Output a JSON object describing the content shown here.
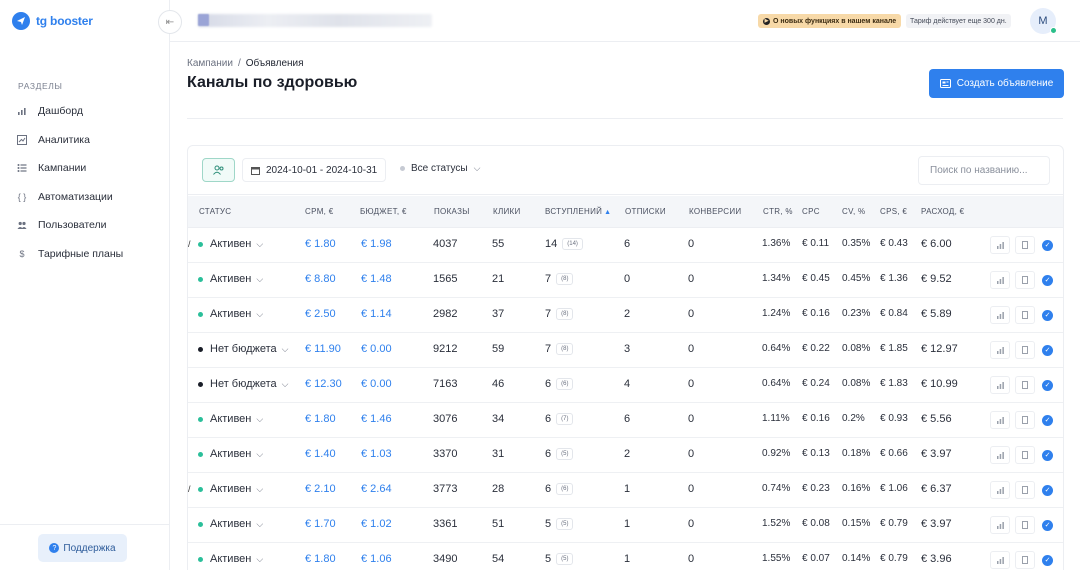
{
  "app": {
    "logo_text": "tg booster"
  },
  "sidebar": {
    "section_title": "РАЗДЕЛЫ",
    "items": [
      {
        "label": "Дашборд",
        "icon": "bar-chart-icon"
      },
      {
        "label": "Аналитика",
        "icon": "analytics-icon"
      },
      {
        "label": "Кампании",
        "icon": "list-icon"
      },
      {
        "label": "Автоматизации",
        "icon": "braces-icon"
      },
      {
        "label": "Пользователи",
        "icon": "users-icon"
      },
      {
        "label": "Тарифные планы",
        "icon": "dollar-icon"
      }
    ],
    "support_label": "Поддержка"
  },
  "topbar": {
    "news_label": "О новых функциях в нашем канале",
    "tariff_label": "Тариф действует еще 300 дн.",
    "avatar_initial": "M"
  },
  "breadcrumb": {
    "parent": "Кампании",
    "separator": "/",
    "current": "Объявления"
  },
  "page_title": "Каналы по здоровью",
  "create_button_label": "Создать объявление",
  "filters": {
    "date_range": "2024-10-01 - 2024-10-31",
    "status_select": "Все статусы",
    "search_placeholder": "Поиск по названию..."
  },
  "table": {
    "headers": {
      "status": "СТАТУС",
      "cpm": "CPM, €",
      "budget": "БЮДЖЕТ, €",
      "views": "ПОКАЗЫ",
      "clicks": "КЛИКИ",
      "joins": "ВСТУПЛЕНИЙ",
      "unsubs": "ОТПИСКИ",
      "conv": "КОНВЕРСИИ",
      "ctr": "CTR, %",
      "cpc": "CPC",
      "cv": "CV, %",
      "cps": "CPS, €",
      "spend": "РАСХОД, €"
    },
    "colors": {
      "active": "#2bbf9a",
      "no_budget": "#1a1e28",
      "link": "#2f80ed"
    },
    "rows": [
      {
        "status": "Активен",
        "active": true,
        "cpm": "€ 1.80",
        "budget": "€ 1.98",
        "views": "4037",
        "clicks": "55",
        "joins": "14",
        "joins_sub": "(14)",
        "unsubs": "6",
        "conv": "0",
        "ctr": "1.36%",
        "cpc": "€ 0.11",
        "cv": "0.35%",
        "cps": "€ 0.43",
        "spend": "€ 6.00",
        "mark": "/"
      },
      {
        "status": "Активен",
        "active": true,
        "cpm": "€ 8.80",
        "budget": "€ 1.48",
        "views": "1565",
        "clicks": "21",
        "joins": "7",
        "joins_sub": "(8)",
        "unsubs": "0",
        "conv": "0",
        "ctr": "1.34%",
        "cpc": "€ 0.45",
        "cv": "0.45%",
        "cps": "€ 1.36",
        "spend": "€ 9.52",
        "mark": ""
      },
      {
        "status": "Активен",
        "active": true,
        "cpm": "€ 2.50",
        "budget": "€ 1.14",
        "views": "2982",
        "clicks": "37",
        "joins": "7",
        "joins_sub": "(8)",
        "unsubs": "2",
        "conv": "0",
        "ctr": "1.24%",
        "cpc": "€ 0.16",
        "cv": "0.23%",
        "cps": "€ 0.84",
        "spend": "€ 5.89",
        "mark": ""
      },
      {
        "status": "Нет бюджета",
        "active": false,
        "cpm": "€ 11.90",
        "budget": "€ 0.00",
        "views": "9212",
        "clicks": "59",
        "joins": "7",
        "joins_sub": "(8)",
        "unsubs": "3",
        "conv": "0",
        "ctr": "0.64%",
        "cpc": "€ 0.22",
        "cv": "0.08%",
        "cps": "€ 1.85",
        "spend": "€ 12.97",
        "mark": ""
      },
      {
        "status": "Нет бюджета",
        "active": false,
        "cpm": "€ 12.30",
        "budget": "€ 0.00",
        "views": "7163",
        "clicks": "46",
        "joins": "6",
        "joins_sub": "(6)",
        "unsubs": "4",
        "conv": "0",
        "ctr": "0.64%",
        "cpc": "€ 0.24",
        "cv": "0.08%",
        "cps": "€ 1.83",
        "spend": "€ 10.99",
        "mark": ""
      },
      {
        "status": "Активен",
        "active": true,
        "cpm": "€ 1.80",
        "budget": "€ 1.46",
        "views": "3076",
        "clicks": "34",
        "joins": "6",
        "joins_sub": "(7)",
        "unsubs": "6",
        "conv": "0",
        "ctr": "1.11%",
        "cpc": "€ 0.16",
        "cv": "0.2%",
        "cps": "€ 0.93",
        "spend": "€ 5.56",
        "mark": ""
      },
      {
        "status": "Активен",
        "active": true,
        "cpm": "€ 1.40",
        "budget": "€ 1.03",
        "views": "3370",
        "clicks": "31",
        "joins": "6",
        "joins_sub": "(5)",
        "unsubs": "2",
        "conv": "0",
        "ctr": "0.92%",
        "cpc": "€ 0.13",
        "cv": "0.18%",
        "cps": "€ 0.66",
        "spend": "€ 3.97",
        "mark": ""
      },
      {
        "status": "Активен",
        "active": true,
        "cpm": "€ 2.10",
        "budget": "€ 2.64",
        "views": "3773",
        "clicks": "28",
        "joins": "6",
        "joins_sub": "(6)",
        "unsubs": "1",
        "conv": "0",
        "ctr": "0.74%",
        "cpc": "€ 0.23",
        "cv": "0.16%",
        "cps": "€ 1.06",
        "spend": "€ 6.37",
        "mark": "/"
      },
      {
        "status": "Активен",
        "active": true,
        "cpm": "€ 1.70",
        "budget": "€ 1.02",
        "views": "3361",
        "clicks": "51",
        "joins": "5",
        "joins_sub": "(5)",
        "unsubs": "1",
        "conv": "0",
        "ctr": "1.52%",
        "cpc": "€ 0.08",
        "cv": "0.15%",
        "cps": "€ 0.79",
        "spend": "€ 3.97",
        "mark": ""
      },
      {
        "status": "Активен",
        "active": true,
        "cpm": "€ 1.80",
        "budget": "€ 1.06",
        "views": "3490",
        "clicks": "54",
        "joins": "5",
        "joins_sub": "(5)",
        "unsubs": "1",
        "conv": "0",
        "ctr": "1.55%",
        "cpc": "€ 0.07",
        "cv": "0.14%",
        "cps": "€ 0.79",
        "spend": "€ 3.96",
        "mark": ""
      }
    ]
  }
}
